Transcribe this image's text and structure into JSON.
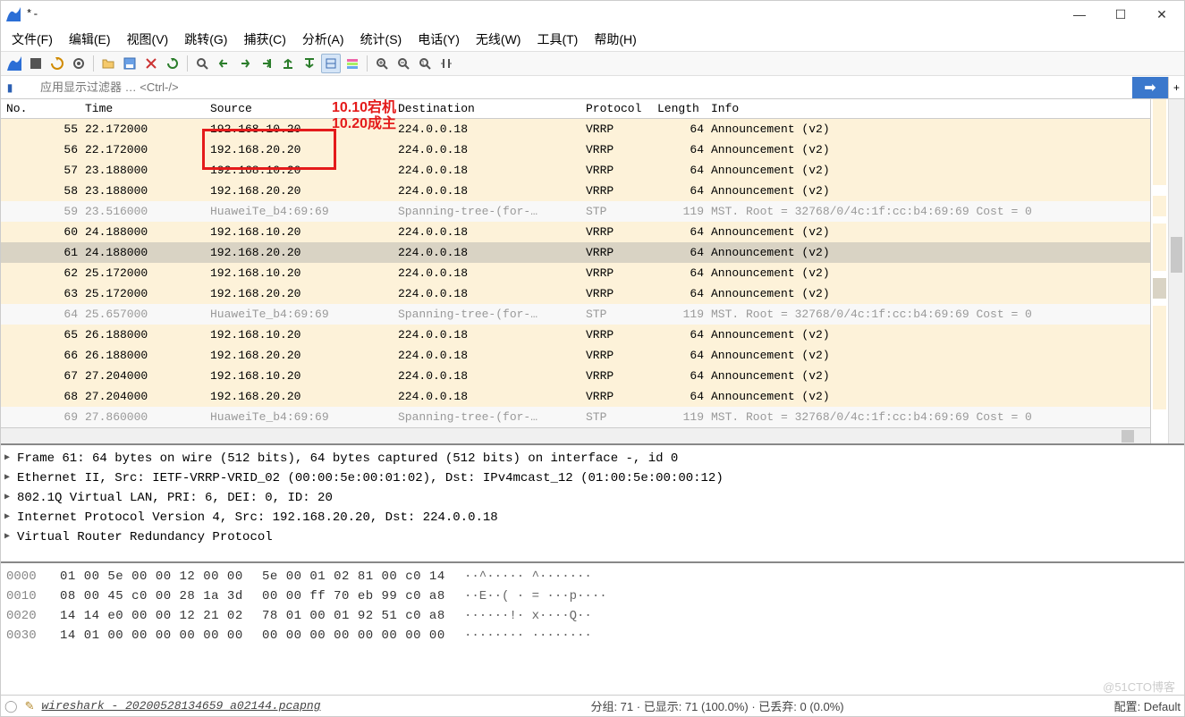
{
  "title": "*-",
  "win_min": "—",
  "win_max": "☐",
  "win_close": "✕",
  "menu": [
    "文件(F)",
    "编辑(E)",
    "视图(V)",
    "跳转(G)",
    "捕获(C)",
    "分析(A)",
    "统计(S)",
    "电话(Y)",
    "无线(W)",
    "工具(T)",
    "帮助(H)"
  ],
  "filter_placeholder": "应用显示过滤器 … <Ctrl-/>",
  "filter_btn": "➡",
  "filter_add": "+",
  "annot1": "10.10宕机",
  "annot2": "10.20成主",
  "columns": {
    "no": "No.",
    "time": "Time",
    "src": "Source",
    "dst": "Destination",
    "proto": "Protocol",
    "len": "Length",
    "info": "Info"
  },
  "rows": [
    {
      "no": "55",
      "time": "22.172000",
      "src": "192.168.10.20",
      "dst": "224.0.0.18",
      "proto": "VRRP",
      "len": "64",
      "info": "Announcement (v2)",
      "cls": "vrrp"
    },
    {
      "no": "56",
      "time": "22.172000",
      "src": "192.168.20.20",
      "dst": "224.0.0.18",
      "proto": "VRRP",
      "len": "64",
      "info": "Announcement (v2)",
      "cls": "vrrp"
    },
    {
      "no": "57",
      "time": "23.188000",
      "src": "192.168.10.20",
      "dst": "224.0.0.18",
      "proto": "VRRP",
      "len": "64",
      "info": "Announcement (v2)",
      "cls": "vrrp"
    },
    {
      "no": "58",
      "time": "23.188000",
      "src": "192.168.20.20",
      "dst": "224.0.0.18",
      "proto": "VRRP",
      "len": "64",
      "info": "Announcement (v2)",
      "cls": "vrrp"
    },
    {
      "no": "59",
      "time": "23.516000",
      "src": "HuaweiTe_b4:69:69",
      "dst": "Spanning-tree-(for-…",
      "proto": "STP",
      "len": "119",
      "info": "MST. Root = 32768/0/4c:1f:cc:b4:69:69  Cost = 0",
      "cls": "stp"
    },
    {
      "no": "60",
      "time": "24.188000",
      "src": "192.168.10.20",
      "dst": "224.0.0.18",
      "proto": "VRRP",
      "len": "64",
      "info": "Announcement (v2)",
      "cls": "vrrp"
    },
    {
      "no": "61",
      "time": "24.188000",
      "src": "192.168.20.20",
      "dst": "224.0.0.18",
      "proto": "VRRP",
      "len": "64",
      "info": "Announcement (v2)",
      "cls": "sel"
    },
    {
      "no": "62",
      "time": "25.172000",
      "src": "192.168.10.20",
      "dst": "224.0.0.18",
      "proto": "VRRP",
      "len": "64",
      "info": "Announcement (v2)",
      "cls": "vrrp"
    },
    {
      "no": "63",
      "time": "25.172000",
      "src": "192.168.20.20",
      "dst": "224.0.0.18",
      "proto": "VRRP",
      "len": "64",
      "info": "Announcement (v2)",
      "cls": "vrrp"
    },
    {
      "no": "64",
      "time": "25.657000",
      "src": "HuaweiTe_b4:69:69",
      "dst": "Spanning-tree-(for-…",
      "proto": "STP",
      "len": "119",
      "info": "MST. Root = 32768/0/4c:1f:cc:b4:69:69  Cost = 0",
      "cls": "stp"
    },
    {
      "no": "65",
      "time": "26.188000",
      "src": "192.168.10.20",
      "dst": "224.0.0.18",
      "proto": "VRRP",
      "len": "64",
      "info": "Announcement (v2)",
      "cls": "vrrp"
    },
    {
      "no": "66",
      "time": "26.188000",
      "src": "192.168.20.20",
      "dst": "224.0.0.18",
      "proto": "VRRP",
      "len": "64",
      "info": "Announcement (v2)",
      "cls": "vrrp"
    },
    {
      "no": "67",
      "time": "27.204000",
      "src": "192.168.10.20",
      "dst": "224.0.0.18",
      "proto": "VRRP",
      "len": "64",
      "info": "Announcement (v2)",
      "cls": "vrrp"
    },
    {
      "no": "68",
      "time": "27.204000",
      "src": "192.168.20.20",
      "dst": "224.0.0.18",
      "proto": "VRRP",
      "len": "64",
      "info": "Announcement (v2)",
      "cls": "vrrp"
    },
    {
      "no": "69",
      "time": "27.860000",
      "src": "HuaweiTe_b4:69:69",
      "dst": "Spanning-tree-(for-…",
      "proto": "STP",
      "len": "119",
      "info": "MST. Root = 32768/0/4c:1f:cc:b4:69:69  Cost = 0",
      "cls": "stp"
    }
  ],
  "details": [
    "Frame 61: 64 bytes on wire (512 bits), 64 bytes captured (512 bits) on interface -, id 0",
    "Ethernet II, Src: IETF-VRRP-VRID_02 (00:00:5e:00:01:02), Dst: IPv4mcast_12 (01:00:5e:00:00:12)",
    "802.1Q Virtual LAN, PRI: 6, DEI: 0, ID: 20",
    "Internet Protocol Version 4, Src: 192.168.20.20, Dst: 224.0.0.18",
    "Virtual Router Redundancy Protocol"
  ],
  "hex": [
    {
      "off": "0000",
      "b1": "01 00 5e 00 00 12 00 00",
      "b2": "5e 00 01 02 81 00 c0 14",
      "asc": "··^····· ^·······"
    },
    {
      "off": "0010",
      "b1": "08 00 45 c0 00 28 1a 3d",
      "b2": "00 00 ff 70 eb 99 c0 a8",
      "asc": "··E··( · = ···p····"
    },
    {
      "off": "0020",
      "b1": "14 14 e0 00 00 12 21 02",
      "b2": "78 01 00 01 92 51 c0 a8",
      "asc": "······!· x····Q··"
    },
    {
      "off": "0030",
      "b1": "14 01 00 00 00 00 00 00",
      "b2": "00 00 00 00 00 00 00 00",
      "asc": "········ ········"
    }
  ],
  "status_file": "wireshark_-_20200528134659_a02144.pcapng",
  "status_mid": "分组: 71 · 已显示: 71 (100.0%) · 已丢弃: 0 (0.0%)",
  "status_right": "配置: Default",
  "watermark": "@51CTO博客"
}
